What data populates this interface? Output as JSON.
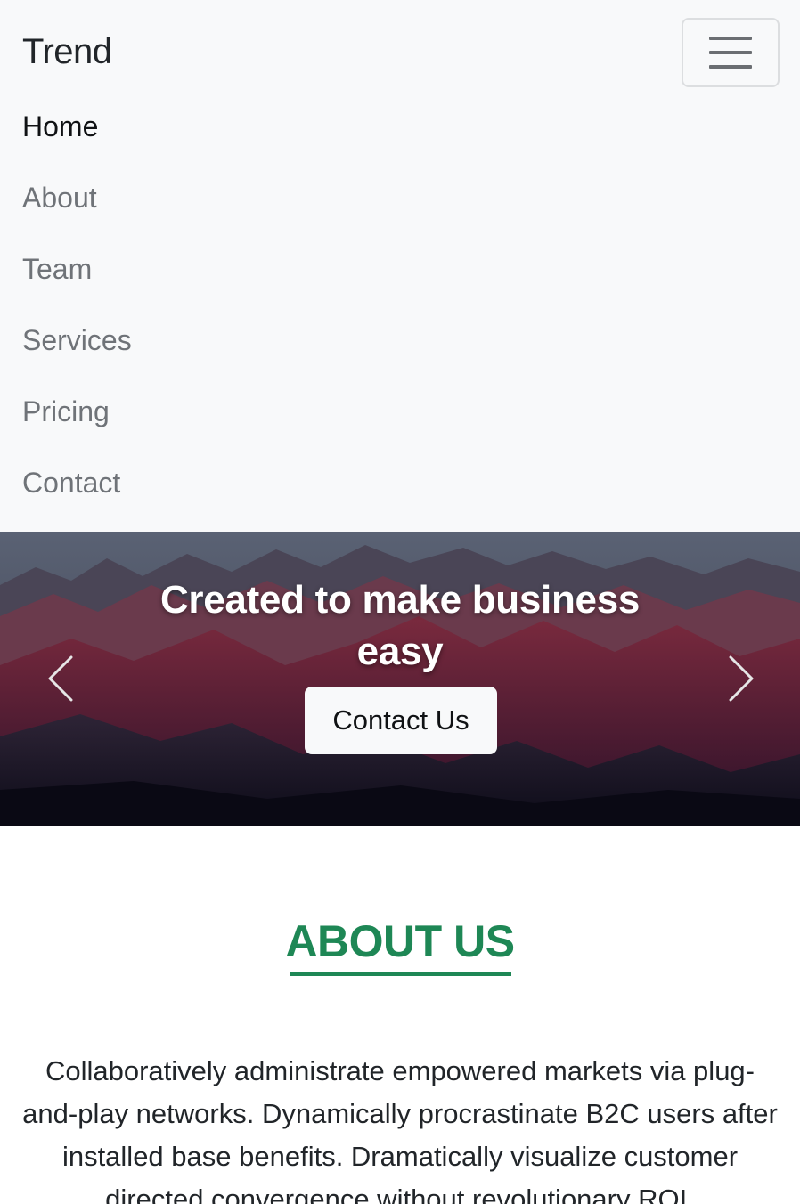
{
  "navbar": {
    "brand": "Trend",
    "toggler_icon": "hamburger-menu-icon",
    "items": [
      {
        "label": "Home",
        "active": true
      },
      {
        "label": "About",
        "active": false
      },
      {
        "label": "Team",
        "active": false
      },
      {
        "label": "Services",
        "active": false
      },
      {
        "label": "Pricing",
        "active": false
      },
      {
        "label": "Contact",
        "active": false
      }
    ]
  },
  "hero": {
    "title": "Created to make business easy",
    "button_label": "Contact Us",
    "prev_icon": "chevron-left-icon",
    "next_icon": "chevron-right-icon"
  },
  "about": {
    "title": "ABOUT US",
    "text": "Collaboratively administrate empowered markets via plug-and-play networks. Dynamically procrastinate B2C users after installed base benefits. Dramatically visualize customer directed convergence without revolutionary ROI."
  },
  "colors": {
    "accent_green": "#1e8755",
    "navbar_bg": "#f8f9fa",
    "nav_link": "#6f7378",
    "nav_link_active": "#101214"
  }
}
